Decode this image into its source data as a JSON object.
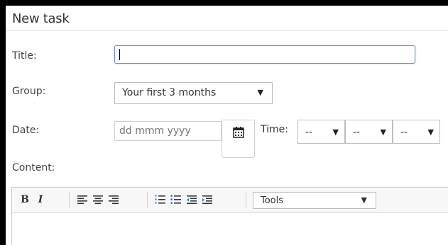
{
  "panel": {
    "title": "New task"
  },
  "form": {
    "title_label": "Title:",
    "title_value": "",
    "group_label": "Group:",
    "group_value": "Your first 3 months",
    "date_label": "Date:",
    "date_placeholder": "dd mmm yyyy",
    "time_label": "Time:",
    "time_hour": "--",
    "time_minute": "--",
    "time_ampm": "--",
    "content_label": "Content:"
  },
  "editor": {
    "bold_label": "B",
    "italic_label": "I",
    "tools_value": "Tools",
    "arrow_glyph": "▼"
  },
  "colors": {
    "focus_border": "#6b8fd8",
    "field_border": "#bdbdbd",
    "text": "#333333",
    "placeholder": "#aaaaaa"
  }
}
